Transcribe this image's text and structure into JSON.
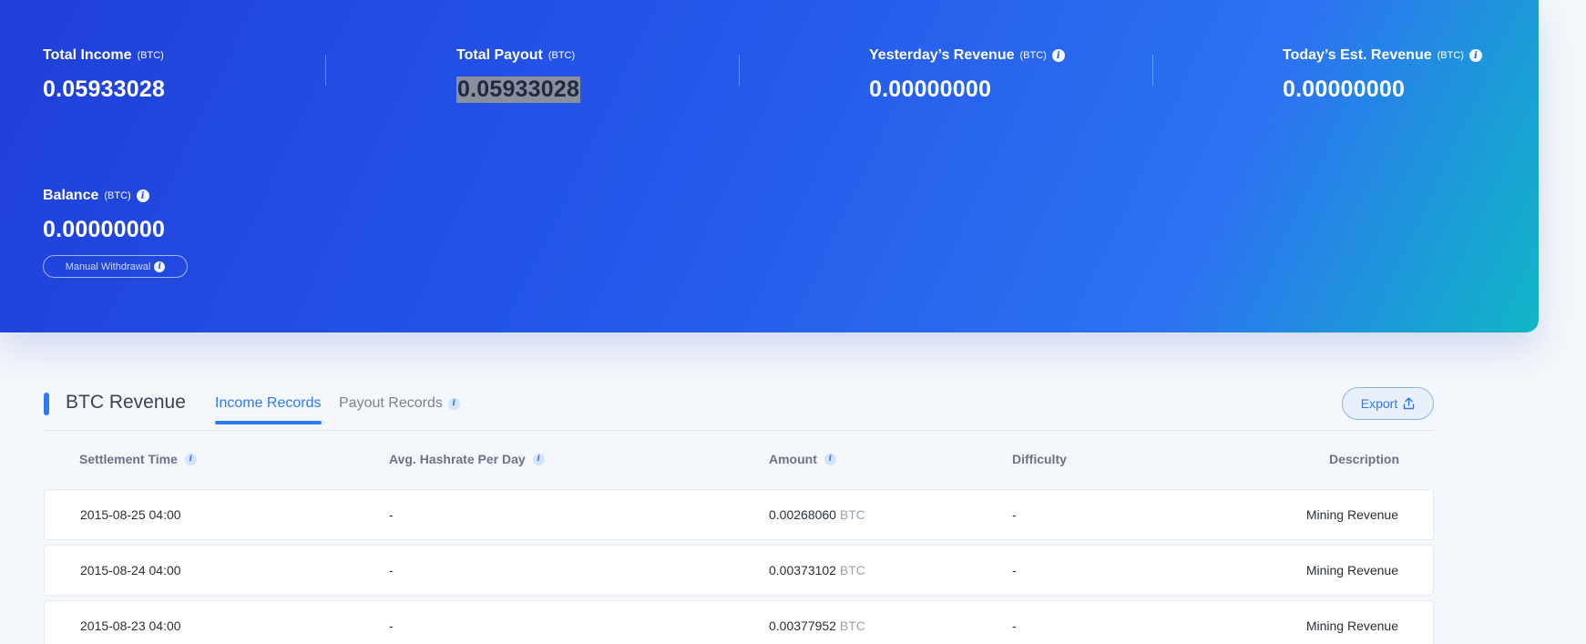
{
  "stats": {
    "total_income": {
      "label": "Total Income",
      "unit": "(BTC)",
      "value": "0.05933028"
    },
    "total_payout": {
      "label": "Total Payout",
      "unit": "(BTC)",
      "value": "0.05933028"
    },
    "yesterday_revenue": {
      "label": "Yesterday’s Revenue",
      "unit": "(BTC)",
      "value": "0.00000000"
    },
    "today_est_revenue": {
      "label": "Today’s Est. Revenue",
      "unit": "(BTC)",
      "value": "0.00000000"
    },
    "balance": {
      "label": "Balance",
      "unit": "(BTC)",
      "value": "0.00000000"
    }
  },
  "manual_withdrawal_label": "Manual Withdrawal",
  "section": {
    "title": "BTC Revenue",
    "tabs": [
      {
        "label": "Income Records",
        "active": true
      },
      {
        "label": "Payout Records",
        "active": false
      }
    ],
    "export_label": "Export"
  },
  "table": {
    "columns": [
      "Settlement Time",
      "Avg. Hashrate Per Day",
      "Amount",
      "Difficulty",
      "Description"
    ],
    "rows": [
      {
        "time": "2015-08-25 04:00",
        "hashrate": "-",
        "amount": "0.00268060",
        "unit": "BTC",
        "difficulty": "-",
        "description": "Mining Revenue"
      },
      {
        "time": "2015-08-24 04:00",
        "hashrate": "-",
        "amount": "0.00373102",
        "unit": "BTC",
        "difficulty": "-",
        "description": "Mining Revenue"
      },
      {
        "time": "2015-08-23 04:00",
        "hashrate": "-",
        "amount": "0.00377952",
        "unit": "BTC",
        "difficulty": "-",
        "description": "Mining Revenue"
      }
    ]
  },
  "colors": {
    "accent": "#2b7cf0",
    "hero_start": "#1f3fd9",
    "hero_end": "#11b6c7"
  },
  "icons": {
    "info": "info-icon",
    "export": "upload-icon"
  }
}
